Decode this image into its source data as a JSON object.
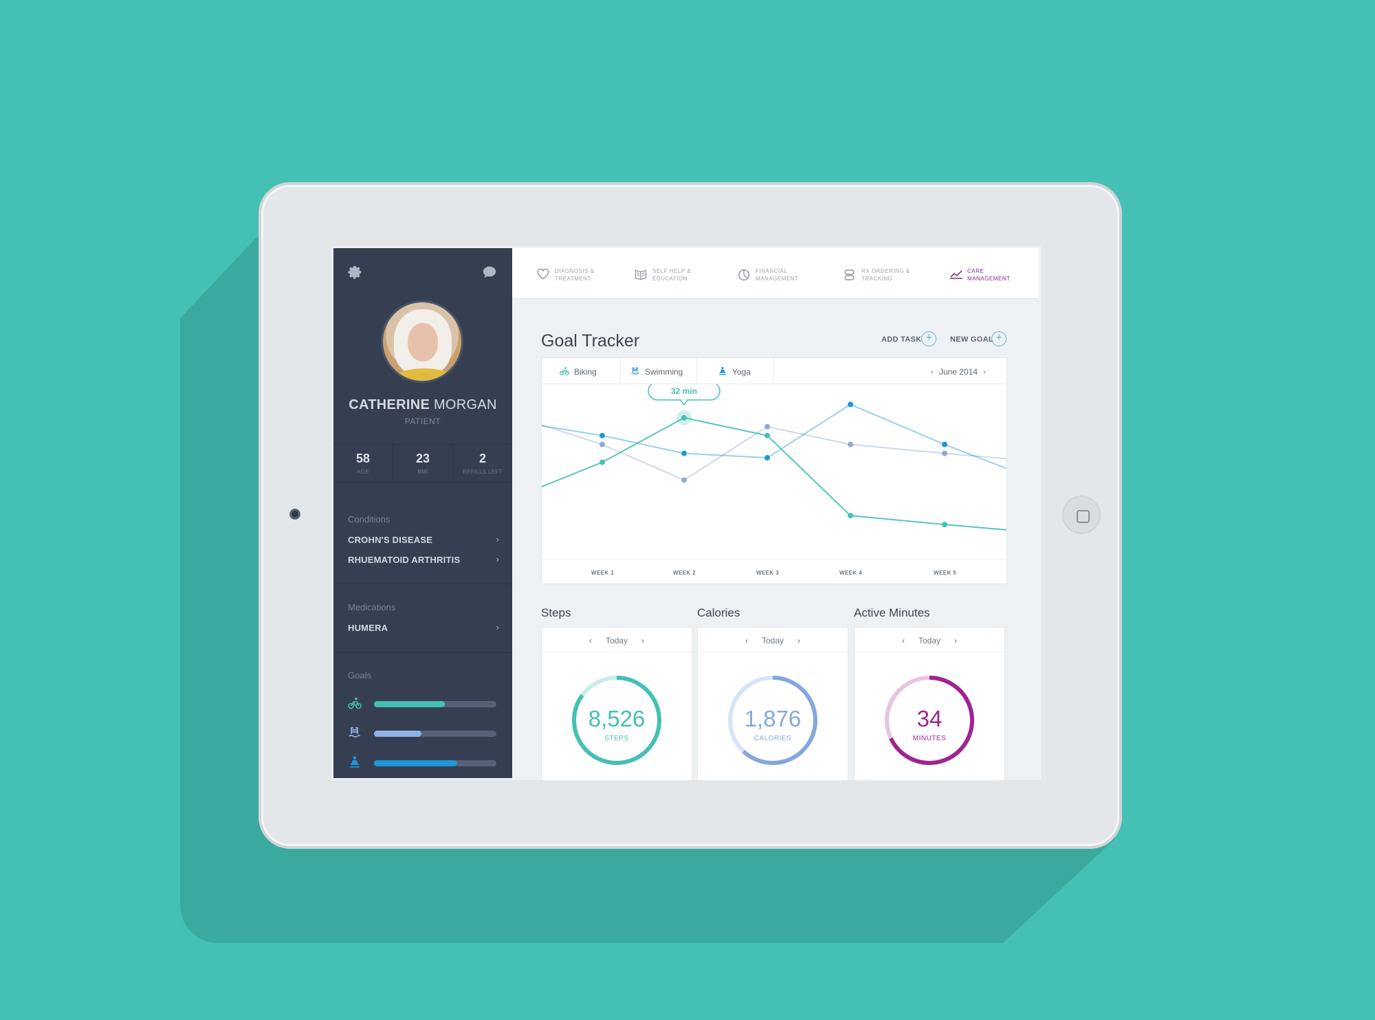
{
  "patient": {
    "first_name": "CATHERINE",
    "last_name": "MORGAN",
    "role": "PATIENT",
    "stats": [
      {
        "value": "58",
        "label": "AGE"
      },
      {
        "value": "23",
        "label": "BMI"
      },
      {
        "value": "2",
        "label": "REFILLS LEFT"
      }
    ]
  },
  "conditions": {
    "title": "Conditions",
    "items": [
      "CROHN'S DISEASE",
      "RHUEMATOID ARTHRITIS"
    ]
  },
  "medications": {
    "title": "Medications",
    "items": [
      "HUMERA"
    ]
  },
  "goals": {
    "title": "Goals",
    "items": [
      {
        "icon": "bike-icon",
        "progress": 0.58,
        "color": "#45c0b5"
      },
      {
        "icon": "swim-icon",
        "progress": 0.39,
        "color": "#8fb3e6"
      },
      {
        "icon": "yoga-icon",
        "progress": 0.68,
        "color": "#2196d8"
      }
    ]
  },
  "nav": [
    {
      "line1": "DIAGNOSIS &",
      "line2": "TREATMENT",
      "icon": "heart-icon",
      "active": false
    },
    {
      "line1": "SELF HELP &",
      "line2": "EDUCATION",
      "icon": "book-icon",
      "active": false
    },
    {
      "line1": "FINANCIAL",
      "line2": "MANAGEMENT",
      "icon": "pie-chart-icon",
      "active": false
    },
    {
      "line1": "Rx ORDERING &",
      "line2": "TRACKING",
      "icon": "pill-icon",
      "active": false
    },
    {
      "line1": "CARE",
      "line2": "MANAGEMENT",
      "icon": "trend-chart-icon",
      "active": true
    }
  ],
  "goal_tracker": {
    "title": "Goal Tracker",
    "add_task": "ADD TASK",
    "new_goal": "NEW GOAL",
    "tabs": [
      "Biking",
      "Swimming",
      "Yoga"
    ],
    "month": "June 2014",
    "tooltip": "32 min"
  },
  "chart_data": {
    "type": "line",
    "categories": [
      "WEEK 1",
      "WEEK 2",
      "WEEK 3",
      "WEEK 4",
      "WEEK 5"
    ],
    "series": [
      {
        "name": "Biking",
        "color": "#45c0b5",
        "values": [
          27,
          32,
          30,
          21,
          20
        ]
      },
      {
        "name": "Swimming",
        "color": "#8fa9d8",
        "values": [
          29,
          25,
          31,
          29,
          28
        ]
      },
      {
        "name": "Yoga",
        "color": "#2196d8",
        "values": [
          30,
          28,
          27.5,
          33.5,
          29
        ]
      }
    ],
    "grid": false,
    "legend": "tabs-top"
  },
  "metrics": [
    {
      "title": "Steps",
      "period": "Today",
      "value": "8,526",
      "label": "STEPS",
      "progress": 0.85,
      "color": "#45c0b5",
      "track": "#c9ece8"
    },
    {
      "title": "Calories",
      "period": "Today",
      "value": "1,876",
      "label": "CALORIES",
      "progress": 0.62,
      "color": "#85a7dc",
      "track": "#d8e4f5"
    },
    {
      "title": "Active Minutes",
      "period": "Today",
      "value": "34",
      "label": "MINUTES",
      "progress": 0.68,
      "color": "#a0248f",
      "track": "#e8c3e2"
    }
  ]
}
